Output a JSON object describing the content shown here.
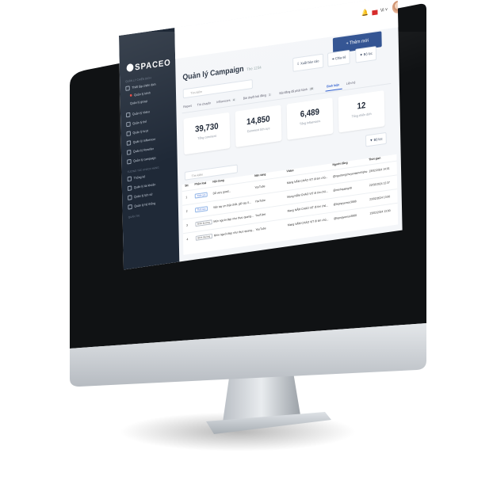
{
  "app": {
    "logo": "SPACEO"
  },
  "sidebar": {
    "groups": [
      "QUẢN LÝ CHIẾN DỊCH",
      "TƯƠNG TÁC KHÁCH HÀNG",
      "QUẢN TRỊ"
    ],
    "items": [
      {
        "label": "Thiết lập chiến dịch"
      },
      {
        "label": "Quản lý kênh"
      },
      {
        "label": "Quản lý group"
      },
      {
        "label": "Quản lý Video"
      },
      {
        "label": "Quản lý thẻ"
      },
      {
        "label": "Quản lý lượt"
      },
      {
        "label": "Quản lý Influencer"
      },
      {
        "label": "Quản lý Reseller"
      },
      {
        "label": "Quản lý campaign"
      },
      {
        "label": "Thống kê"
      },
      {
        "label": "Quản lý tài khoản"
      },
      {
        "label": "Quản lý lịch sử"
      },
      {
        "label": "Quản lý hệ thống"
      }
    ]
  },
  "header": {
    "bell_icon": "bell-icon",
    "language": "Vi",
    "primary_button": "+ Thêm mới"
  },
  "page": {
    "title": "Quản lý Campaign",
    "subtitle": "The 1234",
    "actions": {
      "export": "Xuất báo cáo",
      "share": "Chia sẻ",
      "filter": "Bộ lọc"
    },
    "search_placeholder": "Tìm kiếm"
  },
  "tabs": [
    {
      "label": "Report",
      "badge": ""
    },
    {
      "label": "Trò chuyện",
      "badge": ""
    },
    {
      "label": "Influencers",
      "badge": "4"
    },
    {
      "label": "Bài duyệt bài đăng",
      "badge": "1"
    },
    {
      "label": "Bài đăng đã phát hành",
      "badge": "28"
    },
    {
      "label": "Bình luận",
      "badge": "",
      "active": true
    },
    {
      "label": "Liên hệ",
      "badge": ""
    }
  ],
  "stats": [
    {
      "value": "39,730",
      "label": "Tổng comment"
    },
    {
      "value": "14,850",
      "label": "Comment tích cực"
    },
    {
      "value": "6,489",
      "label": "Tổng Influencers"
    },
    {
      "value": "12",
      "label": "Tổng chiến dịch"
    }
  ],
  "table": {
    "filter_label": "Bộ lọc",
    "search_placeholder": "Tìm kiếm",
    "columns": [
      "Stt",
      "Phân loại",
      "Nội dung",
      "Nền tảng",
      "Video",
      "Người đăng",
      "Thời gian"
    ],
    "rows": [
      {
        "stt": "1",
        "tag": "Tích cực",
        "tag_style": "blue",
        "content": "Dễ very good...",
        "platform": "YouTube",
        "video": "Mang NẤM CHÁO VỊT đi tìm chủ...",
        "user": "@ngoctongchuyentamnhipho",
        "time": "23/02/2024 14:01"
      },
      {
        "stt": "2",
        "tag": "Tích cực",
        "tag_style": "blue",
        "content": "Vấn tay ơn thật chất, giữ tay ít...",
        "platform": "YouTube",
        "video": "Mang NẤM CHÁO VỊT đi tìm chủ...",
        "user": "@minhquang48",
        "time": "22/02/2024 12:37"
      },
      {
        "stt": "3",
        "tag": "Bình thường",
        "tag_style": "gray",
        "content": "Món người đẹp như thực quang...",
        "platform": "YouTube",
        "video": "Mang NẤM CHÁO VỊT đi tìm chủ...",
        "user": "@tepnpyemoc3888",
        "time": "23/02/2024 13:00"
      },
      {
        "stt": "4",
        "tag": "Bình thường",
        "tag_style": "gray",
        "content": "Nhìn người đẹp như thực quang...",
        "platform": "YouTube",
        "video": "Mang NẤM CHÁO VỊT đi tìm chủ...",
        "user": "@tepnpyemoc3888",
        "time": "23/02/2024 13:00"
      }
    ]
  }
}
